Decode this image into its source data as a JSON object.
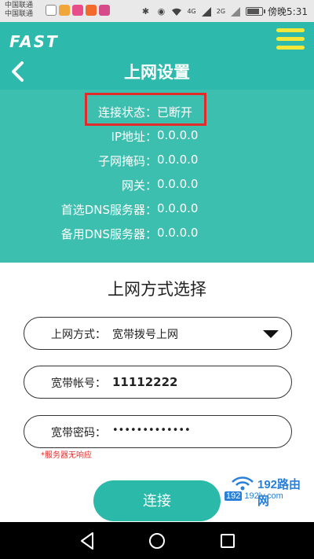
{
  "status_bar": {
    "carrier_1": "中国联通",
    "carrier_2": "中国联通",
    "network_tag": "4G",
    "network_tag2": "2G",
    "time": "傍晚5:31",
    "app_icon_colors": [
      "#f0a63b",
      "#e84d8a",
      "#f26a2e",
      "#d64a8a"
    ],
    "battery_level": 0.9
  },
  "header": {
    "brand": "FAST",
    "title": "上网设置"
  },
  "connection_status": {
    "rows": [
      {
        "label": "连接状态：",
        "value": "已断开"
      },
      {
        "label": "IP地址：",
        "value": "0.0.0.0"
      },
      {
        "label": "子网掩码：",
        "value": "0.0.0.0"
      },
      {
        "label": "网关：",
        "value": "0.0.0.0"
      },
      {
        "label": "首选DNS服务器：",
        "value": "0.0.0.0"
      },
      {
        "label": "备用DNS服务器：",
        "value": "0.0.0.0"
      }
    ]
  },
  "form": {
    "section_title": "上网方式选择",
    "mode_label": "上网方式：",
    "mode_value": "宽带拨号上网",
    "account_label": "宽带帐号：",
    "account_value": "11112222",
    "password_label": "宽带密码：",
    "password_value": "•••••••••••••",
    "hint": "*服务器无响应",
    "connect_label": "连接"
  },
  "watermark": {
    "title": "192路由网",
    "sub_box": "192",
    "sub_text": "192ly.com"
  },
  "colors": {
    "header_bg": "#2db9ab",
    "panel_bg": "#3dbfb0",
    "accent_yellow": "#f3e73a",
    "highlight_red": "#e32a2a"
  }
}
